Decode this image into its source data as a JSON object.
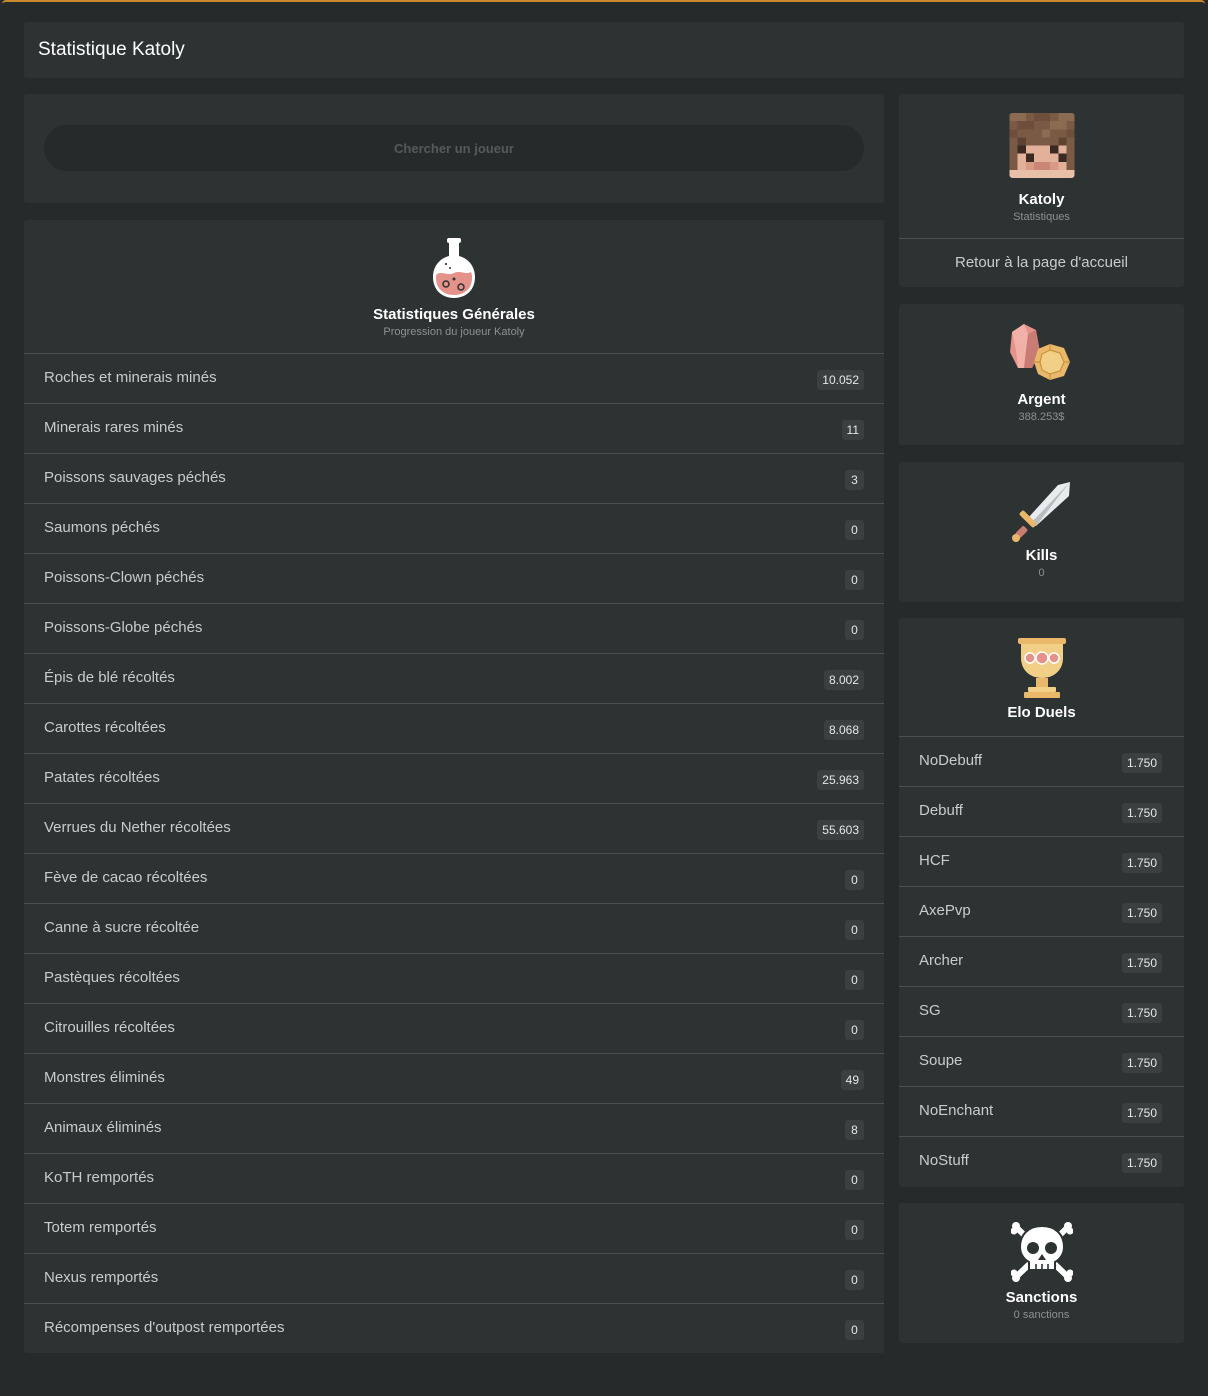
{
  "header": {
    "title": "Statistique Katoly"
  },
  "search": {
    "placeholder": "Chercher un joueur"
  },
  "general": {
    "title": "Statistiques Générales",
    "subtitle": "Progression du joueur Katoly",
    "rows": [
      {
        "label": "Roches et minerais minés",
        "value": "10.052"
      },
      {
        "label": "Minerais rares minés",
        "value": "11"
      },
      {
        "label": "Poissons sauvages péchés",
        "value": "3"
      },
      {
        "label": "Saumons péchés",
        "value": "0"
      },
      {
        "label": "Poissons-Clown péchés",
        "value": "0"
      },
      {
        "label": "Poissons-Globe péchés",
        "value": "0"
      },
      {
        "label": "Épis de blé récoltés",
        "value": "8.002"
      },
      {
        "label": "Carottes récoltées",
        "value": "8.068"
      },
      {
        "label": "Patates récoltées",
        "value": "25.963"
      },
      {
        "label": "Verrues du Nether récoltées",
        "value": "55.603"
      },
      {
        "label": "Fève de cacao récoltées",
        "value": "0"
      },
      {
        "label": "Canne à sucre récoltée",
        "value": "0"
      },
      {
        "label": "Pastèques récoltées",
        "value": "0"
      },
      {
        "label": "Citrouilles récoltées",
        "value": "0"
      },
      {
        "label": "Monstres éliminés",
        "value": "49"
      },
      {
        "label": "Animaux éliminés",
        "value": "8"
      },
      {
        "label": "KoTH remportés",
        "value": "0"
      },
      {
        "label": "Totem remportés",
        "value": "0"
      },
      {
        "label": "Nexus remportés",
        "value": "0"
      },
      {
        "label": "Récompenses d'outpost remportées",
        "value": "0"
      }
    ]
  },
  "profile": {
    "name": "Katoly",
    "subtitle": "Statistiques",
    "home_link": "Retour à la page d'accueil"
  },
  "money": {
    "title": "Argent",
    "value": "388.253$"
  },
  "kills": {
    "title": "Kills",
    "value": "0"
  },
  "elo": {
    "title": "Elo Duels",
    "rows": [
      {
        "label": "NoDebuff",
        "value": "1.750"
      },
      {
        "label": "Debuff",
        "value": "1.750"
      },
      {
        "label": "HCF",
        "value": "1.750"
      },
      {
        "label": "AxePvp",
        "value": "1.750"
      },
      {
        "label": "Archer",
        "value": "1.750"
      },
      {
        "label": "SG",
        "value": "1.750"
      },
      {
        "label": "Soupe",
        "value": "1.750"
      },
      {
        "label": "NoEnchant",
        "value": "1.750"
      },
      {
        "label": "NoStuff",
        "value": "1.750"
      }
    ]
  },
  "sanctions": {
    "title": "Sanctions",
    "value": "0 sanctions"
  },
  "colors": {
    "background": "#262a2b",
    "card": "#2d3233",
    "accent_border": "#c98a2b",
    "badge": "#3a3f40"
  },
  "icons": {
    "stats": "potion-icon",
    "money": "gems-icon",
    "kills": "sword-icon",
    "elo": "trophy-icon",
    "sanctions": "skull-icon"
  }
}
